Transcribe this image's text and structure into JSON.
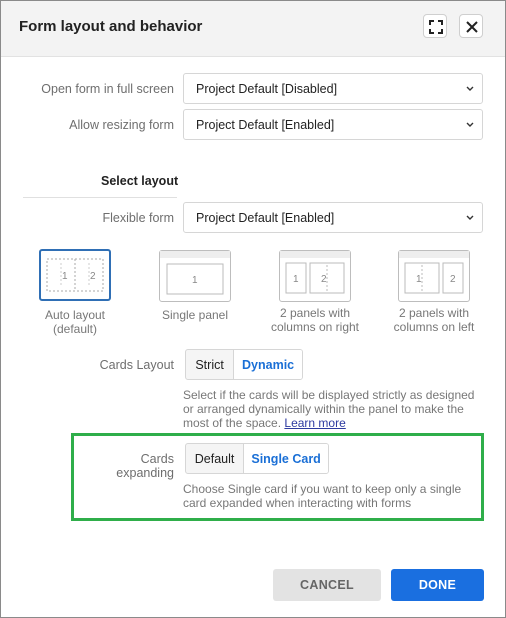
{
  "dialog": {
    "title": "Form layout and behavior"
  },
  "fields": {
    "open_full_screen": {
      "label": "Open form in full screen",
      "value": "Project Default [Disabled]"
    },
    "allow_resizing": {
      "label": "Allow resizing form",
      "value": "Project Default [Enabled]"
    },
    "flexible_form": {
      "label": "Flexible form",
      "value": "Project Default [Enabled]"
    }
  },
  "layout_section": {
    "title": "Select layout",
    "options": [
      {
        "caption": "Auto layout (default)",
        "selected": true,
        "numbers": [
          "1",
          "2"
        ]
      },
      {
        "caption": "Single panel",
        "selected": false,
        "numbers": [
          "1"
        ]
      },
      {
        "caption": "2 panels with columns on right",
        "selected": false,
        "numbers": [
          "1",
          "2"
        ]
      },
      {
        "caption": "2 panels with columns on left",
        "selected": false,
        "numbers": [
          "1",
          "2"
        ]
      }
    ]
  },
  "cards_layout": {
    "label": "Cards Layout",
    "options": [
      "Strict",
      "Dynamic"
    ],
    "selected": "Dynamic",
    "help": "Select if the cards will be displayed strictly as designed or arranged dynamically within the panel to make the most of the space.",
    "learn_more": "Learn more"
  },
  "cards_expanding": {
    "label": "Cards expanding",
    "options": [
      "Default",
      "Single Card"
    ],
    "selected": "Single Card",
    "help": "Choose Single card if you want to keep only a single card expanded when interacting with forms"
  },
  "footer": {
    "cancel": "CANCEL",
    "done": "DONE"
  },
  "colors": {
    "accent": "#1a6fe0",
    "highlight_border": "#2fae4a",
    "selected_option_border": "#2f6fb5"
  }
}
